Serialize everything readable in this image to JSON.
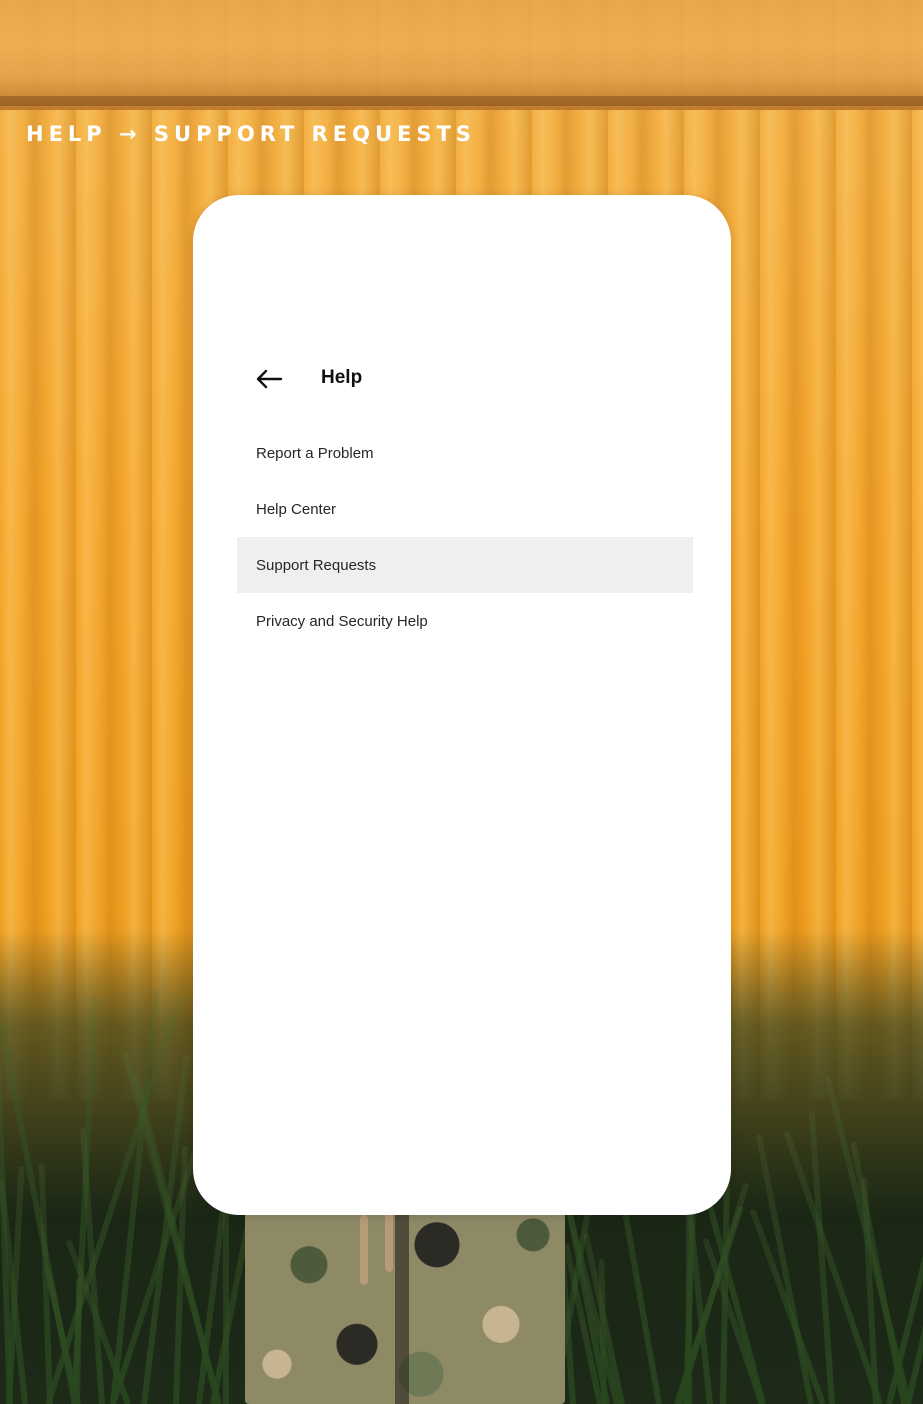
{
  "breadcrumb": {
    "text": "HELP → SUPPORT REQUESTS"
  },
  "screen": {
    "title": "Help",
    "back_icon": "arrow-left-icon"
  },
  "menu": {
    "items": [
      {
        "label": "Report a Problem",
        "selected": false
      },
      {
        "label": "Help Center",
        "selected": false
      },
      {
        "label": "Support Requests",
        "selected": true
      },
      {
        "label": "Privacy and Security Help",
        "selected": false
      }
    ]
  },
  "colors": {
    "background": "#f4a62c",
    "card": "#ffffff",
    "selected_row": "#efefef",
    "text": "#262626"
  }
}
